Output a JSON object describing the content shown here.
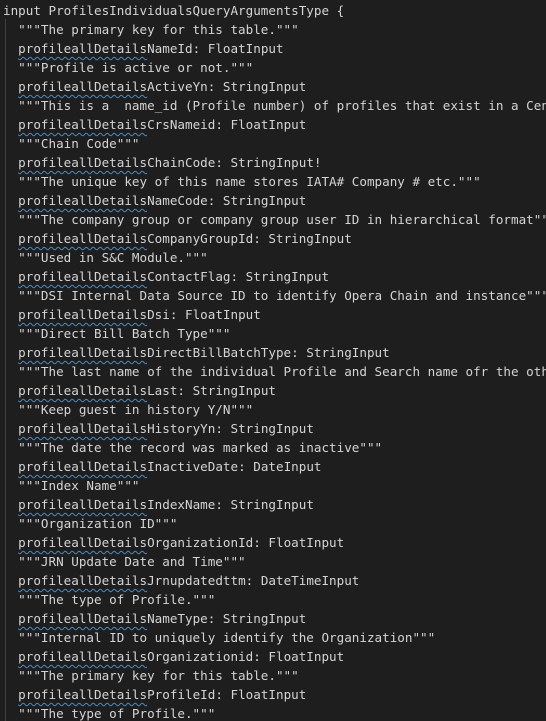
{
  "editor": {
    "header_line": "input ProfilesIndividualsQueryArgumentsType {",
    "indent": "  ",
    "fields": [
      {
        "doc": "\"\"\"The primary key for this table.\"\"\"",
        "prefix": "profileallDetails",
        "suffix": "NameId",
        "type": ": FloatInput"
      },
      {
        "doc": "\"\"\"Profile is active or not.\"\"\"",
        "prefix": "profileallDetails",
        "suffix": "ActiveYn",
        "type": ": StringInput"
      },
      {
        "doc": "\"\"\"This is a  name_id (Profile number) of profiles that exist in a Central Reservation System.\"\"\"",
        "prefix": "profileallDetails",
        "suffix": "CrsNameid",
        "type": ": FloatInput"
      },
      {
        "doc": "\"\"\"Chain Code\"\"\"",
        "prefix": "profileallDetails",
        "suffix": "ChainCode",
        "type": ": StringInput!"
      },
      {
        "doc": "\"\"\"The unique key of this name stores IATA# Company # etc.\"\"\"",
        "prefix": "profileallDetails",
        "suffix": "NameCode",
        "type": ": StringInput"
      },
      {
        "doc": "\"\"\"The company group or company group user ID in hierarchical format\"\"\"",
        "prefix": "profileallDetails",
        "suffix": "CompanyGroupId",
        "type": ": StringInput"
      },
      {
        "doc": "\"\"\"Used in S&C Module.\"\"\"",
        "prefix": "profileallDetails",
        "suffix": "ContactFlag",
        "type": ": StringInput"
      },
      {
        "doc": "\"\"\"DSI Internal Data Source ID to identify Opera Chain and instance\"\"\"",
        "prefix": "profileallDetails",
        "suffix": "Dsi",
        "type": ": FloatInput"
      },
      {
        "doc": "\"\"\"Direct Bill Batch Type\"\"\"",
        "prefix": "profileallDetails",
        "suffix": "DirectBillBatchType",
        "type": ": StringInput"
      },
      {
        "doc": "\"\"\"The last name of the individual Profile and Search name ofr the other profiles\"\"\"",
        "prefix": "profileallDetails",
        "suffix": "Last",
        "type": ": StringInput"
      },
      {
        "doc": "\"\"\"Keep guest in history Y/N\"\"\"",
        "prefix": "profileallDetails",
        "suffix": "HistoryYn",
        "type": ": StringInput"
      },
      {
        "doc": "\"\"\"The date the record was marked as inactive\"\"\"",
        "prefix": "profileallDetails",
        "suffix": "InactiveDate",
        "type": ": DateInput"
      },
      {
        "doc": "\"\"\"Index Name\"\"\"",
        "prefix": "profileallDetails",
        "suffix": "IndexName",
        "type": ": StringInput"
      },
      {
        "doc": "\"\"\"Organization ID\"\"\"",
        "prefix": "profileallDetails",
        "suffix": "OrganizationId",
        "type": ": FloatInput"
      },
      {
        "doc": "\"\"\"JRN Update Date and Time\"\"\"",
        "prefix": "profileallDetails",
        "suffix": "Jrnupdatedttm",
        "type": ": DateTimeInput"
      },
      {
        "doc": "\"\"\"The type of Profile.\"\"\"",
        "prefix": "profileallDetails",
        "suffix": "NameType",
        "type": ": StringInput"
      },
      {
        "doc": "\"\"\"Internal ID to uniquely identify the Organization\"\"\"",
        "prefix": "profileallDetails",
        "suffix": "Organizationid",
        "type": ": FloatInput"
      },
      {
        "doc": "\"\"\"The primary key for this table.\"\"\"",
        "prefix": "profileallDetails",
        "suffix": "ProfileId",
        "type": ": FloatInput"
      }
    ],
    "last_doc": "\"\"\"The type of Profile.\"\"\"",
    "colors": {
      "background": "#1e1e1e",
      "text": "#d4d4d4",
      "squiggle": "#3a8fd6",
      "indent_guide": "#404040"
    }
  }
}
